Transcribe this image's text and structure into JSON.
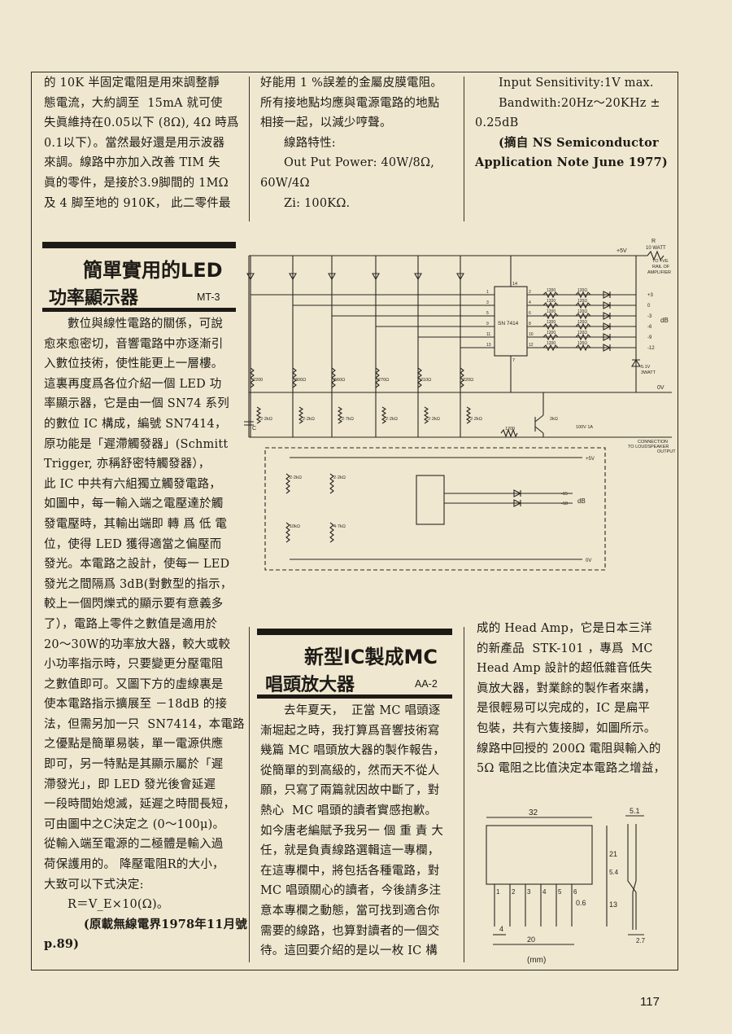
{
  "top": {
    "col1": [
      "的 10K 半固定電阻是用來調整靜",
      "態電流，大約調至  15mA 就可使",
      "失眞維持在0.05以下 (8Ω), 4Ω 時爲",
      "0.1以下）。當然最好還是用示波器",
      "來調。線路中亦加入改善 TIM 失",
      "眞的零件，是接於3.9脚間的 1MΩ",
      "及 4 脚至地的 910K， 此二零件最"
    ],
    "col2": [
      "好能用 1 %誤差的金屬皮膜電阻。",
      "所有接地點均應與電源電路的地點",
      "相接一起，以減少哼聲。",
      "線路特性:",
      "Out Put Power: 40W/8Ω,",
      "60W/4Ω",
      "Zi: 100KΩ."
    ],
    "col3": [
      "Input Sensitivity:1V max.",
      "Bandwith:20Hz～20KHz ±",
      "0.25dB",
      "(摘自 NS Semiconductor",
      "Application Note June 1977)"
    ]
  },
  "led_article": {
    "title_line1": "簡單實用的LED",
    "title_line2": "功率顯示器",
    "code": "MT-3",
    "lines": [
      "數位與線性電路的關係，可說",
      "愈來愈密切，音響電路中亦逐漸引",
      "入數位技術，使性能更上一層樓。",
      "這裏再度爲各位介紹一個 LED 功",
      "率顯示器，它是由一個 SN74 系列",
      "的數位 IC 構成，編號 SN7414，",
      "原功能是「遲滯觸發器」(Schmitt",
      "Trigger, 亦稱舒密特觸發器），",
      "此 IC 中共有六組獨立觸發電路，",
      "如圖中，每一輸入端之電壓達於觸",
      "發電壓時，其輸出端即 轉 爲 低 電",
      "位，使得 LED 獲得適當之偏壓而",
      "發光。本電路之設計，使每一 LED",
      "發光之間隔爲 3dB(對數型的指示，",
      "較上一個閃爍式的顯示要有意義多",
      "了），電路上零件之數值是適用於",
      "20～30W的功率放大器，較大或較",
      "小功率指示時，只要變更分壓電阻",
      "之數值即可。又圖下方的虛線裏是",
      "使本電路指示擴展至 －18dB 的接",
      "法，但需另加一只  SN7414，本電路",
      "之優點是簡單易裝，單一電源供應",
      "即可，另一特點是其顯示屬於「遲",
      "滯發光」，即 LED 發光後會延遲",
      "一段時間始熄滅，延遲之時間長短，",
      "可由圖中之C決定之 (0～100μ)。",
      "從輸入端至電源的二極體是輸入過",
      "荷保護用的。 降壓電阻R的大小，",
      "大致可以下式決定:",
      "R＝V_E×10(Ω)。",
      "(原載無線電界1978年11月號",
      "p.89)"
    ]
  },
  "mc_article": {
    "title_line1": "新型IC製成MC",
    "title_line2": "唱頭放大器",
    "code": "AA-2",
    "col_left": [
      "去年夏天，  正當 MC 唱頭逐",
      "漸堀起之時，我打算爲音響技術寫",
      "幾篇 MC 唱頭放大器的製作報告，",
      "從簡單的到高級的，然而天不從人",
      "願，只寫了兩篇就因故中斷了，對",
      "熱心  MC 唱頭的讀者實感抱歉。",
      "如今唐老編賦予我另一 個 重 責 大",
      "任，就是負責線路選輯這一專欄，",
      "在這專欄中，將包括各種電路，對",
      "MC 唱頭關心的讀者，今後請多注",
      "意本專欄之動態，當可找到適合你",
      "需要的線路，也算對讀者的一個交",
      "待。這回要介紹的是以一枚 IC 構"
    ],
    "col_right": [
      "成的 Head Amp，它是日本三洋",
      "的新產品  STK-101 ，專爲  MC",
      "Head Amp 設計的超低雜音低失",
      "眞放大器，對業餘的製作者來講，",
      "是很輕易可以完成的，IC 是扁平",
      "包裝，共有六隻接脚，如圖所示。",
      "線路中回授的 200Ω 電阻與輸入的",
      "5Ω 電阻之比值決定本電路之增益，"
    ]
  },
  "schematic": {
    "supply": "+5V",
    "supply2": "+5V",
    "ground": "0V",
    "ground2": "0V",
    "r_label": "R",
    "r_watt": "10 WATT",
    "rail_note": [
      "TO +VE",
      "RAIL OF",
      "AMPLIFIER"
    ],
    "ic": "SN 7414",
    "db_unit": "dB",
    "db_unit2": "dB",
    "db_levels": [
      "+3",
      "0",
      "-3",
      "-6",
      "-9",
      "-12"
    ],
    "db_levels2": [
      "-15",
      "-18"
    ],
    "ic_pins_left": [
      "1",
      "3",
      "5",
      "9",
      "11",
      "13"
    ],
    "ic_pins_right": [
      "2",
      "4",
      "6",
      "8",
      "10",
      "12"
    ],
    "pin14": "14",
    "pin7": "7",
    "r_series": "1200",
    "r_led": "120Ω",
    "divider_top": [
      "2200",
      "300Ω",
      "560Ω",
      "270Ω",
      "210Ω",
      "220Ω"
    ],
    "divider_bottom": [
      "2·2kΩ",
      "2·2kΩ",
      "2·7kΩ",
      "2·2kΩ",
      "2·2kΩ",
      "2·2kΩ",
      "2kΩ"
    ],
    "zener": [
      "5.1V",
      "3WATT"
    ],
    "cap": "C",
    "cap_input": "100V 1A",
    "connection": [
      "CONNECTION",
      "TO LOUDSPEAKER",
      "OUTPUT"
    ],
    "ext_resistors": [
      "2·2kΩ",
      "2·2kΩ",
      "10kΩ",
      "4·7kΩ"
    ]
  },
  "package": {
    "dims": [
      "32",
      "5.1",
      "21",
      "5.4",
      "13",
      "0.6",
      "4",
      "20",
      "2.7"
    ],
    "pins": [
      "1",
      "2",
      "3",
      "4",
      "5",
      "6"
    ],
    "unit": "(mm)"
  },
  "page_number": "117"
}
